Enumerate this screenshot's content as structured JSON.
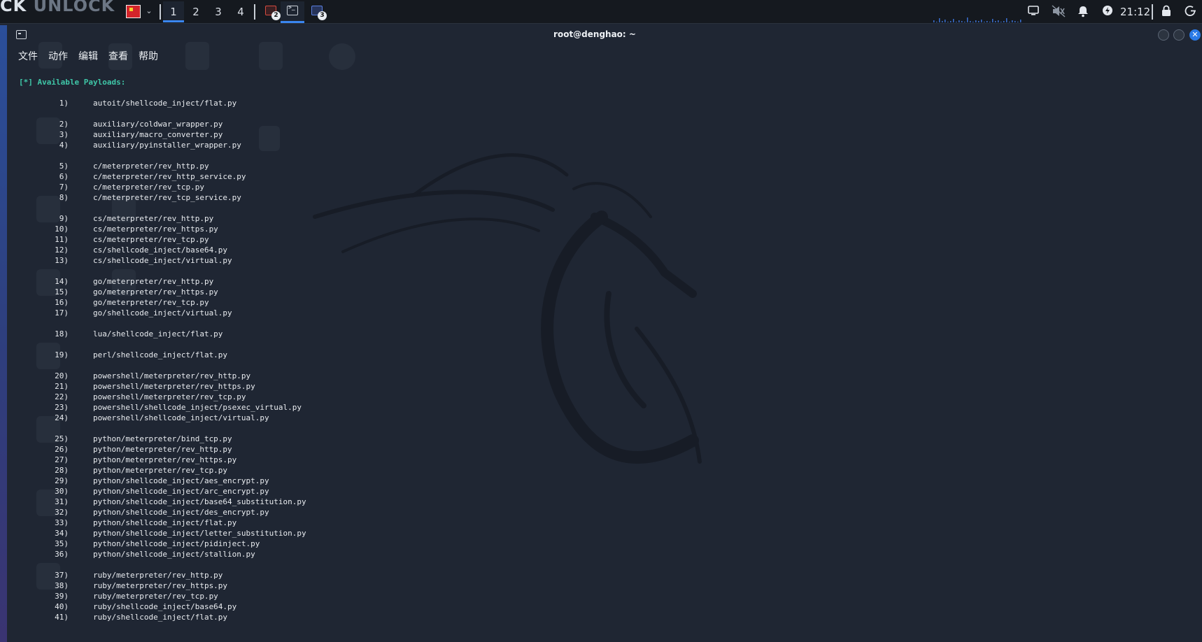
{
  "taskbar": {
    "brand_main": "CK",
    "brand_dim": "UNLOCK",
    "workspaces": [
      "1",
      "2",
      "3",
      "4"
    ],
    "active_workspace": 0,
    "tasks": [
      {
        "icon": "app-icon",
        "badge": "2"
      },
      {
        "icon": "terminal-icon",
        "badge": ""
      },
      {
        "icon": "window-icon",
        "badge": "3"
      }
    ],
    "clock": "21:12",
    "accent": "#3a86f0"
  },
  "window": {
    "title": "root@denghao: ~",
    "menu": [
      "文件",
      "动作",
      "编辑",
      "查看",
      "帮助"
    ]
  },
  "terminal": {
    "header": "[*] Available Payloads:",
    "groups": [
      [
        [
          "1)",
          "autoit/shellcode_inject/flat.py"
        ]
      ],
      [
        [
          "2)",
          "auxiliary/coldwar_wrapper.py"
        ],
        [
          "3)",
          "auxiliary/macro_converter.py"
        ],
        [
          "4)",
          "auxiliary/pyinstaller_wrapper.py"
        ]
      ],
      [
        [
          "5)",
          "c/meterpreter/rev_http.py"
        ],
        [
          "6)",
          "c/meterpreter/rev_http_service.py"
        ],
        [
          "7)",
          "c/meterpreter/rev_tcp.py"
        ],
        [
          "8)",
          "c/meterpreter/rev_tcp_service.py"
        ]
      ],
      [
        [
          "9)",
          "cs/meterpreter/rev_http.py"
        ],
        [
          "10)",
          "cs/meterpreter/rev_https.py"
        ],
        [
          "11)",
          "cs/meterpreter/rev_tcp.py"
        ],
        [
          "12)",
          "cs/shellcode_inject/base64.py"
        ],
        [
          "13)",
          "cs/shellcode_inject/virtual.py"
        ]
      ],
      [
        [
          "14)",
          "go/meterpreter/rev_http.py"
        ],
        [
          "15)",
          "go/meterpreter/rev_https.py"
        ],
        [
          "16)",
          "go/meterpreter/rev_tcp.py"
        ],
        [
          "17)",
          "go/shellcode_inject/virtual.py"
        ]
      ],
      [
        [
          "18)",
          "lua/shellcode_inject/flat.py"
        ]
      ],
      [
        [
          "19)",
          "perl/shellcode_inject/flat.py"
        ]
      ],
      [
        [
          "20)",
          "powershell/meterpreter/rev_http.py"
        ],
        [
          "21)",
          "powershell/meterpreter/rev_https.py"
        ],
        [
          "22)",
          "powershell/meterpreter/rev_tcp.py"
        ],
        [
          "23)",
          "powershell/shellcode_inject/psexec_virtual.py"
        ],
        [
          "24)",
          "powershell/shellcode_inject/virtual.py"
        ]
      ],
      [
        [
          "25)",
          "python/meterpreter/bind_tcp.py"
        ],
        [
          "26)",
          "python/meterpreter/rev_http.py"
        ],
        [
          "27)",
          "python/meterpreter/rev_https.py"
        ],
        [
          "28)",
          "python/meterpreter/rev_tcp.py"
        ],
        [
          "29)",
          "python/shellcode_inject/aes_encrypt.py"
        ],
        [
          "30)",
          "python/shellcode_inject/arc_encrypt.py"
        ],
        [
          "31)",
          "python/shellcode_inject/base64_substitution.py"
        ],
        [
          "32)",
          "python/shellcode_inject/des_encrypt.py"
        ],
        [
          "33)",
          "python/shellcode_inject/flat.py"
        ],
        [
          "34)",
          "python/shellcode_inject/letter_substitution.py"
        ],
        [
          "35)",
          "python/shellcode_inject/pidinject.py"
        ],
        [
          "36)",
          "python/shellcode_inject/stallion.py"
        ]
      ],
      [
        [
          "37)",
          "ruby/meterpreter/rev_http.py"
        ],
        [
          "38)",
          "ruby/meterpreter/rev_https.py"
        ],
        [
          "39)",
          "ruby/meterpreter/rev_tcp.py"
        ],
        [
          "40)",
          "ruby/shellcode_inject/base64.py"
        ],
        [
          "41)",
          "ruby/shellcode_inject/flat.py"
        ]
      ]
    ],
    "header_color": "#3fc7a8",
    "text_color": "#e8ebef"
  }
}
